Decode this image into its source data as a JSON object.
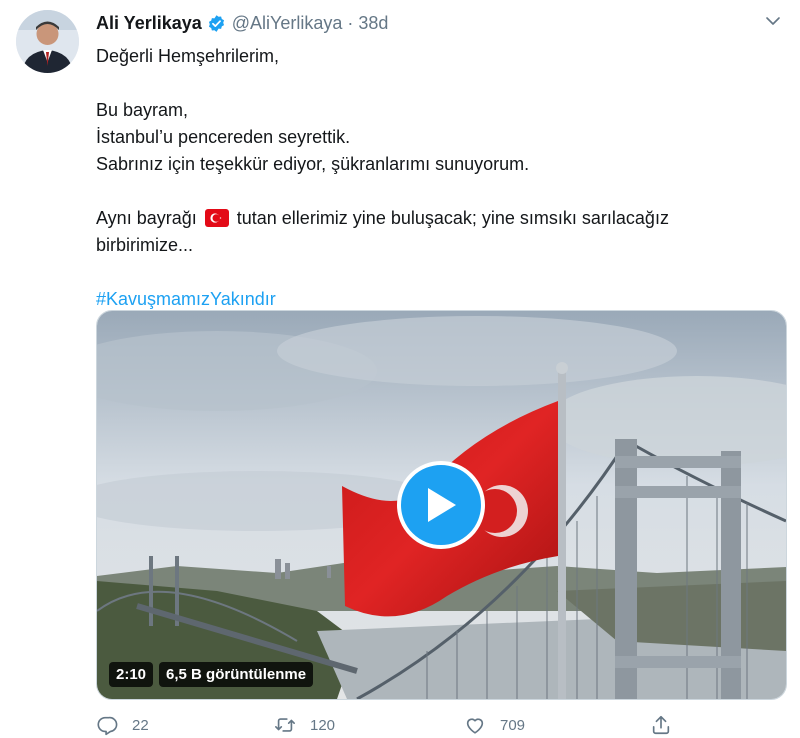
{
  "tweet": {
    "author_name": "Ali Yerlikaya",
    "handle": "@AliYerlikaya",
    "separator": "·",
    "time": "38d",
    "lines": [
      "Değerli Hemşehrilerim,",
      "Bu bayram,",
      "İstanbul’u pencereden seyrettik.",
      "Sabrınız için teşekkür ediyor, şükranlarımı sunuyorum.",
      "Aynı bayrağı",
      "tutan ellerimiz yine buluşacak; yine sımsıkı sarılacağız",
      "birbirimize..."
    ],
    "hashtag": "#KavuşmamızYakındır",
    "flag_emoji": "flag-turkey-emoji"
  },
  "video": {
    "duration": "2:10",
    "views": "6,5 B görüntülenme"
  },
  "actions": {
    "replies": "22",
    "retweets": "120",
    "likes": "709"
  },
  "icons": [
    "verified-badge-icon",
    "chevron-down-icon",
    "play-icon",
    "reply-icon",
    "retweet-icon",
    "like-icon",
    "share-icon"
  ],
  "colors": {
    "accent": "#1da1f2",
    "muted": "#657786",
    "text": "#14171a",
    "flag_red": "#e30a17"
  }
}
